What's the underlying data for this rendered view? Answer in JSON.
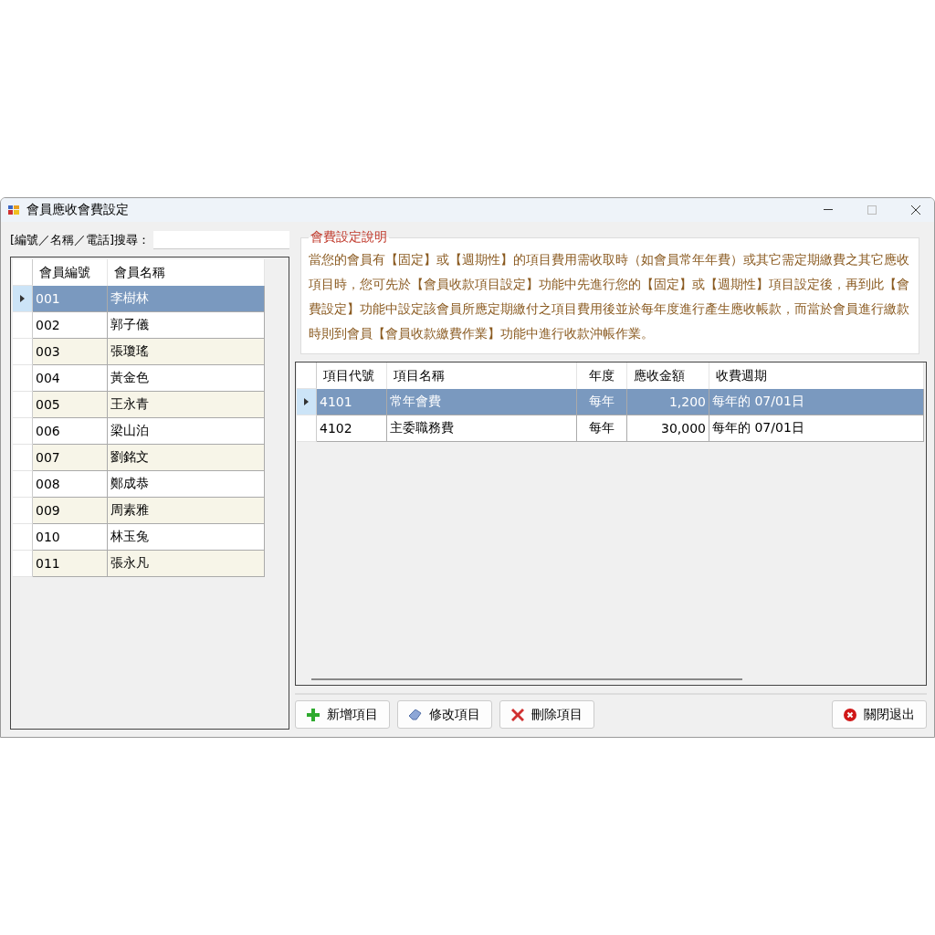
{
  "window": {
    "title": "會員應收會費設定"
  },
  "search": {
    "label": "[編號／名稱／電話]搜尋："
  },
  "members": {
    "columns": [
      "會員編號",
      "會員名稱"
    ],
    "rows": [
      {
        "id": "001",
        "name": "李樹林",
        "selected": true
      },
      {
        "id": "002",
        "name": "郭子儀",
        "selected": false
      },
      {
        "id": "003",
        "name": "張瓊瑤",
        "selected": false
      },
      {
        "id": "004",
        "name": "黃金色",
        "selected": false
      },
      {
        "id": "005",
        "name": "王永青",
        "selected": false
      },
      {
        "id": "006",
        "name": "梁山泊",
        "selected": false
      },
      {
        "id": "007",
        "name": "劉銘文",
        "selected": false
      },
      {
        "id": "008",
        "name": "鄭成恭",
        "selected": false
      },
      {
        "id": "009",
        "name": "周素雅",
        "selected": false
      },
      {
        "id": "010",
        "name": "林玉兔",
        "selected": false
      },
      {
        "id": "011",
        "name": "張永凡",
        "selected": false
      }
    ]
  },
  "help": {
    "title": "會費設定說明",
    "text": "當您的會員有【固定】或【週期性】的項目費用需收取時（如會員常年年費）或其它需定期繳費之其它應收項目時，您可先於【會員收款項目設定】功能中先進行您的【固定】或【週期性】項目設定後，再到此【會費設定】功能中設定該會員所應定期繳付之項目費用後並於每年度進行產生應收帳款，而當於會員進行繳款時則到會員【會員收款繳費作業】功能中進行收款沖帳作業。"
  },
  "items": {
    "columns": [
      "項目代號",
      "項目名稱",
      "年度",
      "應收金額",
      "收費週期"
    ],
    "rows": [
      {
        "code": "4101",
        "name": "常年會費",
        "year": "每年",
        "amount": "1,200",
        "cycle": "每年的 07/01日",
        "selected": true
      },
      {
        "code": "4102",
        "name": "主委職務費",
        "year": "每年",
        "amount": "30,000",
        "cycle": "每年的 07/01日",
        "selected": false
      }
    ]
  },
  "buttons": [
    {
      "kind": "add",
      "label": "新增項目"
    },
    {
      "kind": "edit",
      "label": "修改項目"
    },
    {
      "kind": "delete",
      "label": "刪除項目"
    },
    {
      "kind": "close",
      "label": "關閉退出"
    }
  ]
}
